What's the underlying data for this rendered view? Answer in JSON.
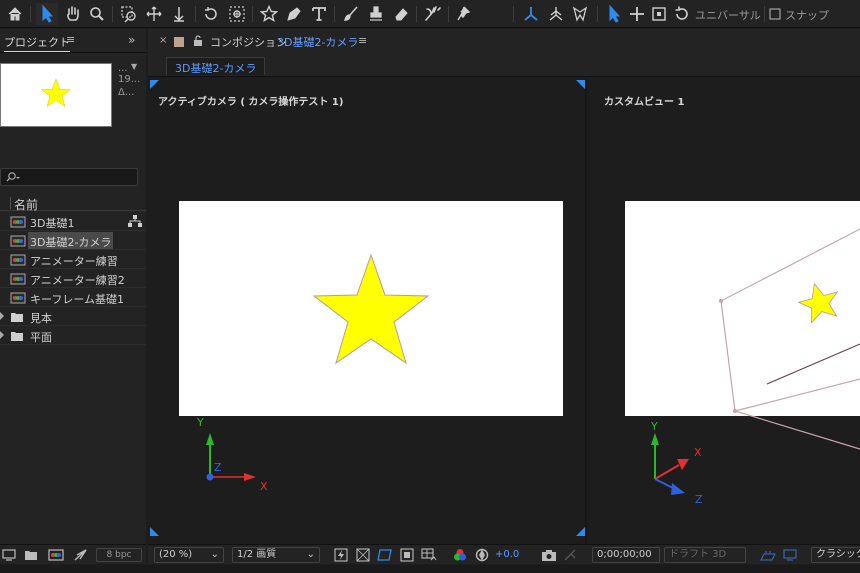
{
  "toolbar": {
    "universal_label": "ユニバーサル",
    "snap_label": "スナップ"
  },
  "project": {
    "tab_label": "プロジェクト",
    "menu_glyph": "≡",
    "expand_glyph": "»",
    "thumb_info": [
      "...",
      "19...",
      "Δ..."
    ],
    "search_placeholder": "",
    "column_name": "名前",
    "items": [
      {
        "label": "3D基礎1",
        "type": "comp"
      },
      {
        "label": "3D基礎2-カメラ",
        "type": "comp",
        "selected": true
      },
      {
        "label": "アニメーター練習",
        "type": "comp"
      },
      {
        "label": "アニメーター練習2",
        "type": "comp"
      },
      {
        "label": "キーフレーム基礎1",
        "type": "comp"
      },
      {
        "label": "見本",
        "type": "folder"
      },
      {
        "label": "平面",
        "type": "folder"
      }
    ],
    "bpc": "8 bpc"
  },
  "composition": {
    "close_glyph": "×",
    "title_prefix": "コンポジション",
    "title_name": "3D基礎2-カメラ",
    "menu_glyph": "≡",
    "flow_tab": "3D基礎2-カメラ",
    "left_view_title": "アクティブカメラ ( カメラ操作テスト 1)",
    "right_view_title": "カスタムビュー 1",
    "axis_labels": {
      "x": "X",
      "y": "Y",
      "z": "Z"
    }
  },
  "comp_bottom": {
    "zoom": "(20 %)",
    "resolution": "1/2 画質",
    "exposure": "+0.0",
    "timecode": "0;00;00;00",
    "draft3d": "ドラフト 3D",
    "renderer": "クラシック"
  },
  "colors": {
    "accent": "#2d8ceb",
    "link_blue": "#64a0ff",
    "star_fill": "#ffff00",
    "axis_x": "#e03030",
    "axis_y": "#2bb82b",
    "axis_z": "#3060e0"
  }
}
